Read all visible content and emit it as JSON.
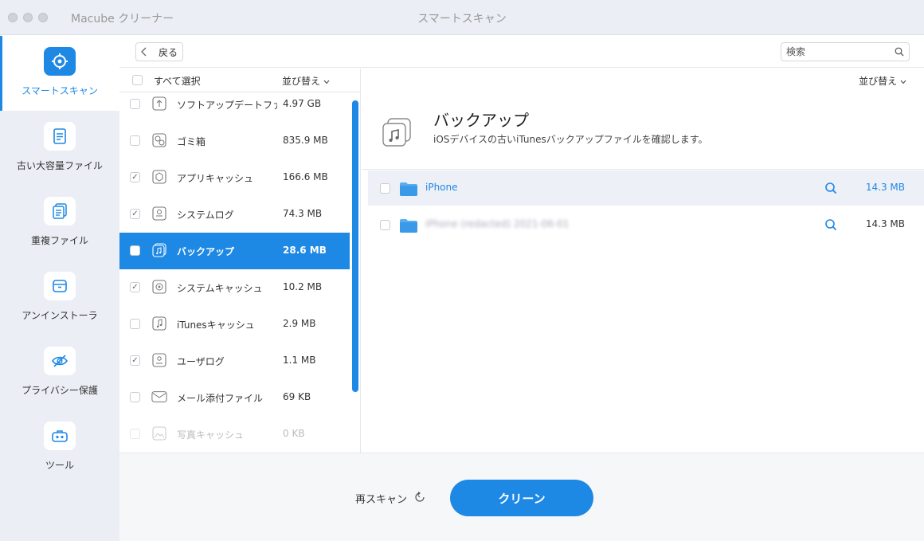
{
  "window": {
    "app_title": "Macube クリーナー",
    "title": "スマートスキャン"
  },
  "sidebar": {
    "items": [
      {
        "label": "スマートスキャン",
        "icon": "target-icon",
        "active": true
      },
      {
        "label": "古い大容量ファイル",
        "icon": "document-icon",
        "active": false
      },
      {
        "label": "重複ファイル",
        "icon": "duplicate-file-icon",
        "active": false
      },
      {
        "label": "アンインストーラ",
        "icon": "archive-box-icon",
        "active": false
      },
      {
        "label": "プライバシー保護",
        "icon": "eye-slash-icon",
        "active": false
      },
      {
        "label": "ツール",
        "icon": "toolbox-icon",
        "active": false
      }
    ]
  },
  "toolbar": {
    "back_label": "戻る",
    "search_placeholder": "検索"
  },
  "categories": {
    "select_all_label": "すべて選択",
    "sort_label": "並び替え",
    "items": [
      {
        "name": "ソフトアップデートファイル",
        "size": "4.97 GB",
        "checked": false,
        "icon": "upload-icon"
      },
      {
        "name": "ゴミ箱",
        "size": "835.9 MB",
        "checked": false,
        "icon": "trash-icon"
      },
      {
        "name": "アプリキャッシュ",
        "size": "166.6 MB",
        "checked": true,
        "icon": "app-cache-icon"
      },
      {
        "name": "システムログ",
        "size": "74.3 MB",
        "checked": true,
        "icon": "system-log-icon"
      },
      {
        "name": "バックアップ",
        "size": "28.6 MB",
        "checked": false,
        "icon": "backup-music-icon",
        "selected": true
      },
      {
        "name": "システムキャッシュ",
        "size": "10.2 MB",
        "checked": true,
        "icon": "system-cache-icon"
      },
      {
        "name": "iTunesキャッシュ",
        "size": "2.9 MB",
        "checked": false,
        "icon": "music-note-icon"
      },
      {
        "name": "ユーザログ",
        "size": "1.1 MB",
        "checked": true,
        "icon": "user-log-icon"
      },
      {
        "name": "メール添付ファイル",
        "size": "69 KB",
        "checked": false,
        "icon": "mail-icon"
      },
      {
        "name": "写真キャッシュ",
        "size": "0 KB",
        "checked": false,
        "icon": "photo-icon",
        "disabled": true
      }
    ]
  },
  "detail": {
    "sort_label": "並び替え",
    "title": "バックアップ",
    "description": "iOSデバイスの古いiTunesバックアップファイルを確認します。",
    "files": [
      {
        "name": "iPhone",
        "size": "14.3 MB",
        "highlighted": true
      },
      {
        "name": "iPhone (redacted) 2021-06-01",
        "size": "14.3 MB",
        "highlighted": false,
        "redacted": true
      }
    ]
  },
  "bottom": {
    "rescan_label": "再スキャン",
    "clean_label": "クリーン"
  },
  "colors": {
    "accent": "#1e88e5",
    "sidebar_bg": "#ebeef4",
    "row_highlight": "#eef0f7"
  }
}
